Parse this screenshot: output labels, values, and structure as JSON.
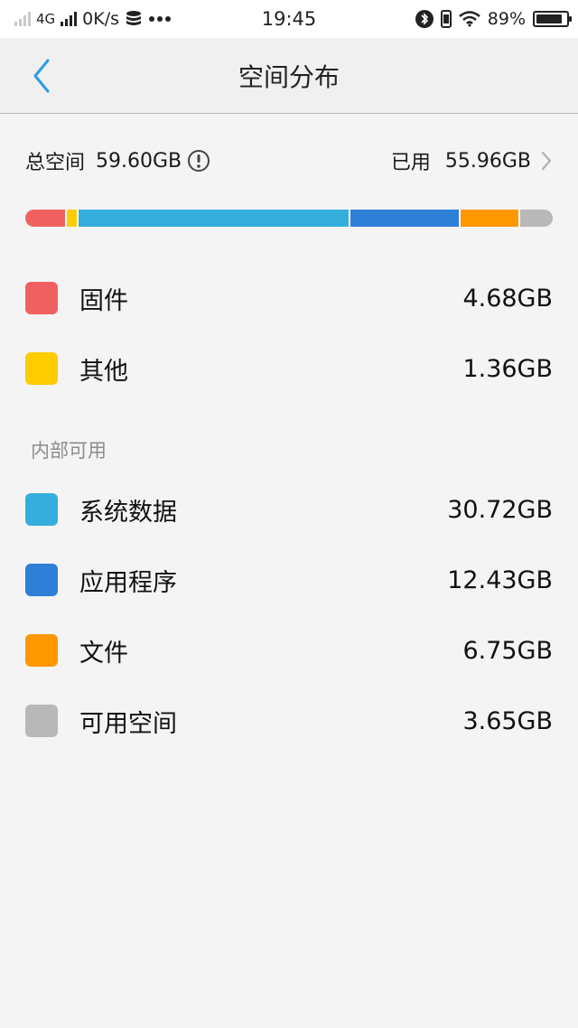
{
  "status_bar": {
    "network": "4G",
    "speed": "0K/s",
    "time": "19:45",
    "battery": "89%",
    "battery_level": 0.89,
    "icons": [
      "signal-icon",
      "database-icon",
      "more-icon",
      "bluetooth-icon",
      "vibrate-icon",
      "wifi-icon",
      "battery-icon"
    ]
  },
  "header": {
    "title": "空间分布",
    "back_icon": "chevron-left-icon"
  },
  "summary": {
    "total_label": "总空间",
    "total_value": "59.60GB",
    "used_label": "已用",
    "used_value": "55.96GB"
  },
  "colors": {
    "accent": "#2b9be8",
    "firmware": "#f06060",
    "other": "#ffcc00",
    "system": "#35aedd",
    "apps": "#2d7fd8",
    "files": "#ff9800",
    "free": "#b8b8b8"
  },
  "storage_bar": {
    "segments": [
      {
        "key": "firmware",
        "gb": 4.68
      },
      {
        "key": "other",
        "gb": 1.36
      },
      {
        "key": "system",
        "gb": 30.72
      },
      {
        "key": "apps",
        "gb": 12.43
      },
      {
        "key": "files",
        "gb": 6.75
      },
      {
        "key": "free",
        "gb": 3.65
      }
    ]
  },
  "items": [
    {
      "label": "固件",
      "value": "4.68GB",
      "color": "#f06060"
    },
    {
      "label": "其他",
      "value": "1.36GB",
      "color": "#ffcc00"
    }
  ],
  "internal_section": {
    "label": "内部可用",
    "items": [
      {
        "label": "系统数据",
        "value": "30.72GB",
        "color": "#35aedd"
      },
      {
        "label": "应用程序",
        "value": "12.43GB",
        "color": "#2d7fd8"
      },
      {
        "label": "文件",
        "value": "6.75GB",
        "color": "#ff9800"
      },
      {
        "label": "可用空间",
        "value": "3.65GB",
        "color": "#b8b8b8"
      }
    ]
  }
}
